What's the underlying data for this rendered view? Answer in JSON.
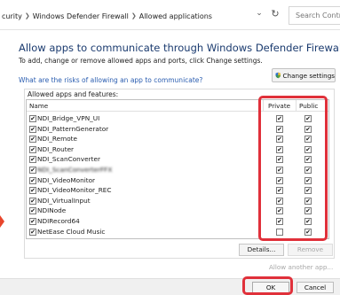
{
  "address_bar": {
    "crumbs": [
      "curity",
      "Windows Defender Firewall",
      "Allowed applications"
    ],
    "search_placeholder": "Search Control"
  },
  "main": {
    "heading": "Allow apps to communicate through Windows Defender Firewall",
    "subtext": "To add, change or remove allowed apps and ports, click Change settings.",
    "risk_link": "What are the risks of allowing an app to communicate?",
    "change_settings_label": "Change settings"
  },
  "apps_group": {
    "label": "Allowed apps and features:",
    "columns": {
      "name": "Name",
      "private": "Private",
      "public": "Public"
    },
    "rows": [
      {
        "name": "NDI_Bridge_VPN_UI",
        "enabled": true,
        "private": true,
        "public": true
      },
      {
        "name": "NDI_PatternGenerator",
        "enabled": true,
        "private": true,
        "public": true
      },
      {
        "name": "NDI_Remote",
        "enabled": true,
        "private": true,
        "public": true
      },
      {
        "name": "NDI_Router",
        "enabled": true,
        "private": true,
        "public": true
      },
      {
        "name": "NDI_ScanConverter",
        "enabled": true,
        "private": true,
        "public": true
      },
      {
        "name": "NDI_ScanConverterFFX",
        "enabled": true,
        "private": true,
        "public": true
      },
      {
        "name": "NDI_VideoMonitor",
        "enabled": true,
        "private": true,
        "public": true
      },
      {
        "name": "NDI_VideoMonitor_REC",
        "enabled": true,
        "private": true,
        "public": true
      },
      {
        "name": "NDI_VirtualInput",
        "enabled": true,
        "private": true,
        "public": true
      },
      {
        "name": "NDINode",
        "enabled": true,
        "private": true,
        "public": true
      },
      {
        "name": "NDIRecord64",
        "enabled": true,
        "private": true,
        "public": true
      },
      {
        "name": "NetEase Cloud Music",
        "enabled": true,
        "private": false,
        "public": true
      }
    ],
    "details_label": "Details...",
    "remove_label": "Remove",
    "allow_another_label": "Allow another app..."
  },
  "footer": {
    "ok_label": "OK",
    "cancel_label": "Cancel"
  },
  "colors": {
    "heading": "#1b3b6f",
    "link": "#2a5db0",
    "highlight": "#e0303a"
  }
}
